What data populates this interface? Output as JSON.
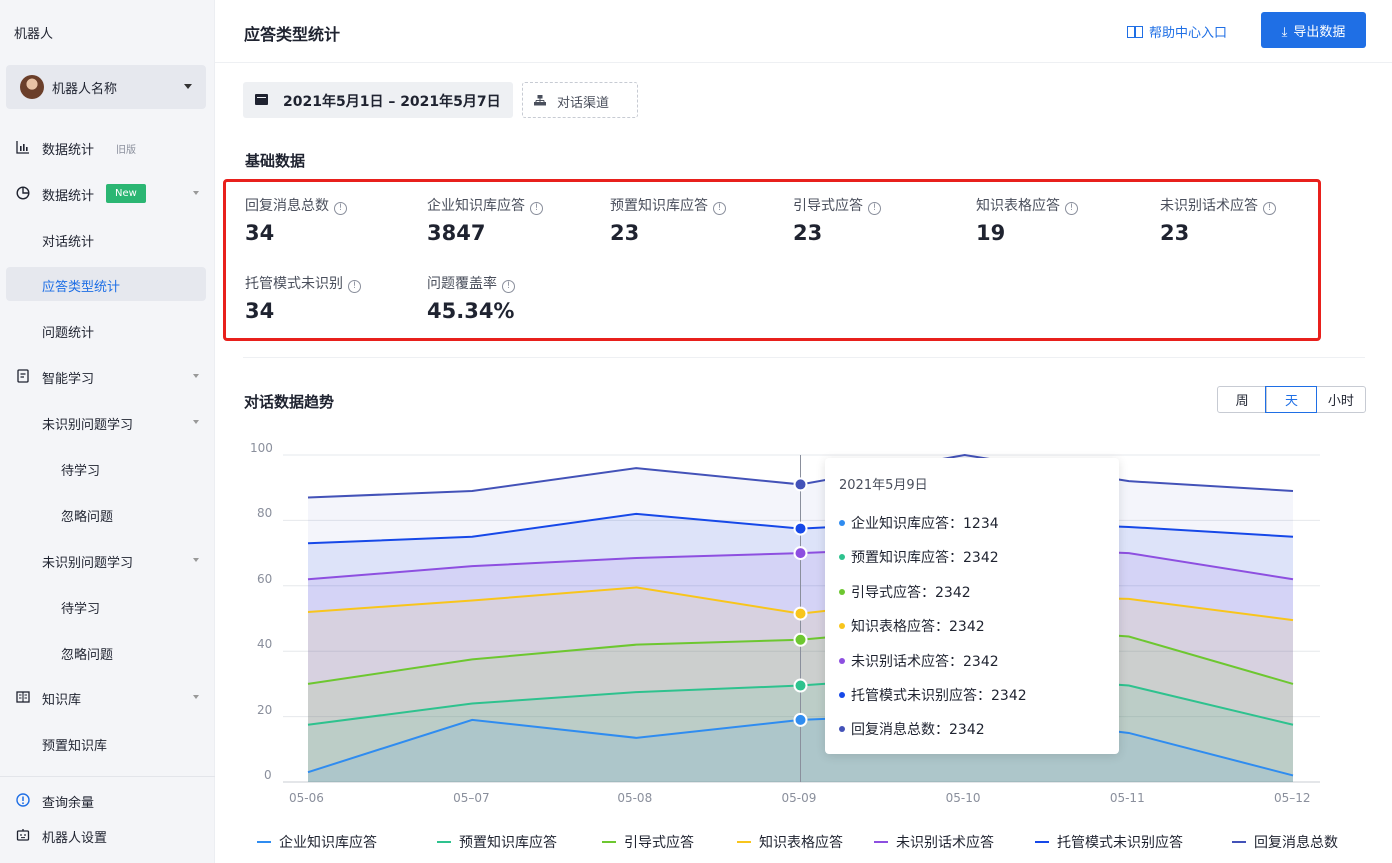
{
  "sidebar": {
    "title": "机器人",
    "bot_name": "机器人名称",
    "items": [
      {
        "label": "数据统计",
        "tag": "旧版"
      },
      {
        "label": "数据统计",
        "tag": "New"
      },
      {
        "label": "对话统计"
      },
      {
        "label": "应答类型统计"
      },
      {
        "label": "问题统计"
      },
      {
        "label": "智能学习"
      },
      {
        "label": "未识别问题学习"
      },
      {
        "label": "待学习"
      },
      {
        "label": "忽略问题"
      },
      {
        "label": "未识别问题学习"
      },
      {
        "label": "待学习"
      },
      {
        "label": "忽略问题"
      },
      {
        "label": "知识库"
      },
      {
        "label": "预置知识库"
      },
      {
        "label": "查询余量"
      },
      {
        "label": "机器人设置"
      }
    ]
  },
  "header": {
    "title": "应答类型统计",
    "help_label": "帮助中心入口",
    "export_label": "导出数据"
  },
  "filters": {
    "date_range": "2021年5月1日 – 2021年5月7日",
    "channel_label": "对话渠道"
  },
  "basic": {
    "title": "基础数据",
    "stats": [
      {
        "label": "回复消息总数",
        "value": "34"
      },
      {
        "label": "企业知识库应答",
        "value": "3847"
      },
      {
        "label": "预置知识库应答",
        "value": "23"
      },
      {
        "label": "引导式应答",
        "value": "23"
      },
      {
        "label": "知识表格应答",
        "value": "19"
      },
      {
        "label": "未识别话术应答",
        "value": "23"
      },
      {
        "label": "托管模式未识别",
        "value": "34"
      },
      {
        "label": "问题覆盖率",
        "value": "45.34%"
      }
    ]
  },
  "trend": {
    "title": "对话数据趋势",
    "segments": [
      "周",
      "天",
      "小时"
    ],
    "active_segment": "天"
  },
  "tooltip": {
    "date": "2021年5月9日",
    "rows": [
      {
        "label": "企业知识库应答：1234",
        "color": "#2f8cf0"
      },
      {
        "label": "预置知识库应答：2342",
        "color": "#2ec28e"
      },
      {
        "label": "引导式应答：2342",
        "color": "#6dc730"
      },
      {
        "label": "知识表格应答：2342",
        "color": "#f8c51c"
      },
      {
        "label": "未识别话术应答：2342",
        "color": "#8d4fe0"
      },
      {
        "label": "托管模式未识别应答：2342",
        "color": "#1648e8"
      },
      {
        "label": "回复消息总数：2342",
        "color": "#4352b8"
      }
    ]
  },
  "chart_data": {
    "type": "area",
    "categories": [
      "05-06",
      "05–07",
      "05-08",
      "05-09",
      "05-10",
      "05-11",
      "05–12"
    ],
    "ylim": [
      0,
      100
    ],
    "yticks": [
      "0",
      "20",
      "40",
      "60",
      "80",
      "100"
    ],
    "grid": true,
    "legend_position": "bottom",
    "series": [
      {
        "name": "企业知识库应答",
        "color": "#2f8cf0",
        "values": [
          3,
          19,
          13.5,
          19,
          21,
          15,
          2
        ]
      },
      {
        "name": "预置知识库应答",
        "color": "#2ec28e",
        "values": [
          17.5,
          24,
          27.5,
          29.5,
          33,
          29.5,
          17.5
        ]
      },
      {
        "name": "引导式应答",
        "color": "#6dc730",
        "values": [
          30,
          37.5,
          42,
          43.5,
          48,
          44.5,
          30
        ]
      },
      {
        "name": "知识表格应答",
        "color": "#f8c51c",
        "values": [
          52,
          55.5,
          59.5,
          51.5,
          57,
          56,
          49.5
        ]
      },
      {
        "name": "未识别话术应答",
        "color": "#8d4fe0",
        "values": [
          62,
          66,
          68.5,
          70,
          72,
          70,
          62
        ]
      },
      {
        "name": "托管模式未识别应答",
        "color": "#1648e8",
        "values": [
          73,
          75,
          82,
          77.5,
          80,
          78,
          75
        ]
      },
      {
        "name": "回复消息总数",
        "color": "#4352b8",
        "values": [
          87,
          89,
          96,
          91,
          100,
          92,
          89
        ]
      }
    ]
  }
}
